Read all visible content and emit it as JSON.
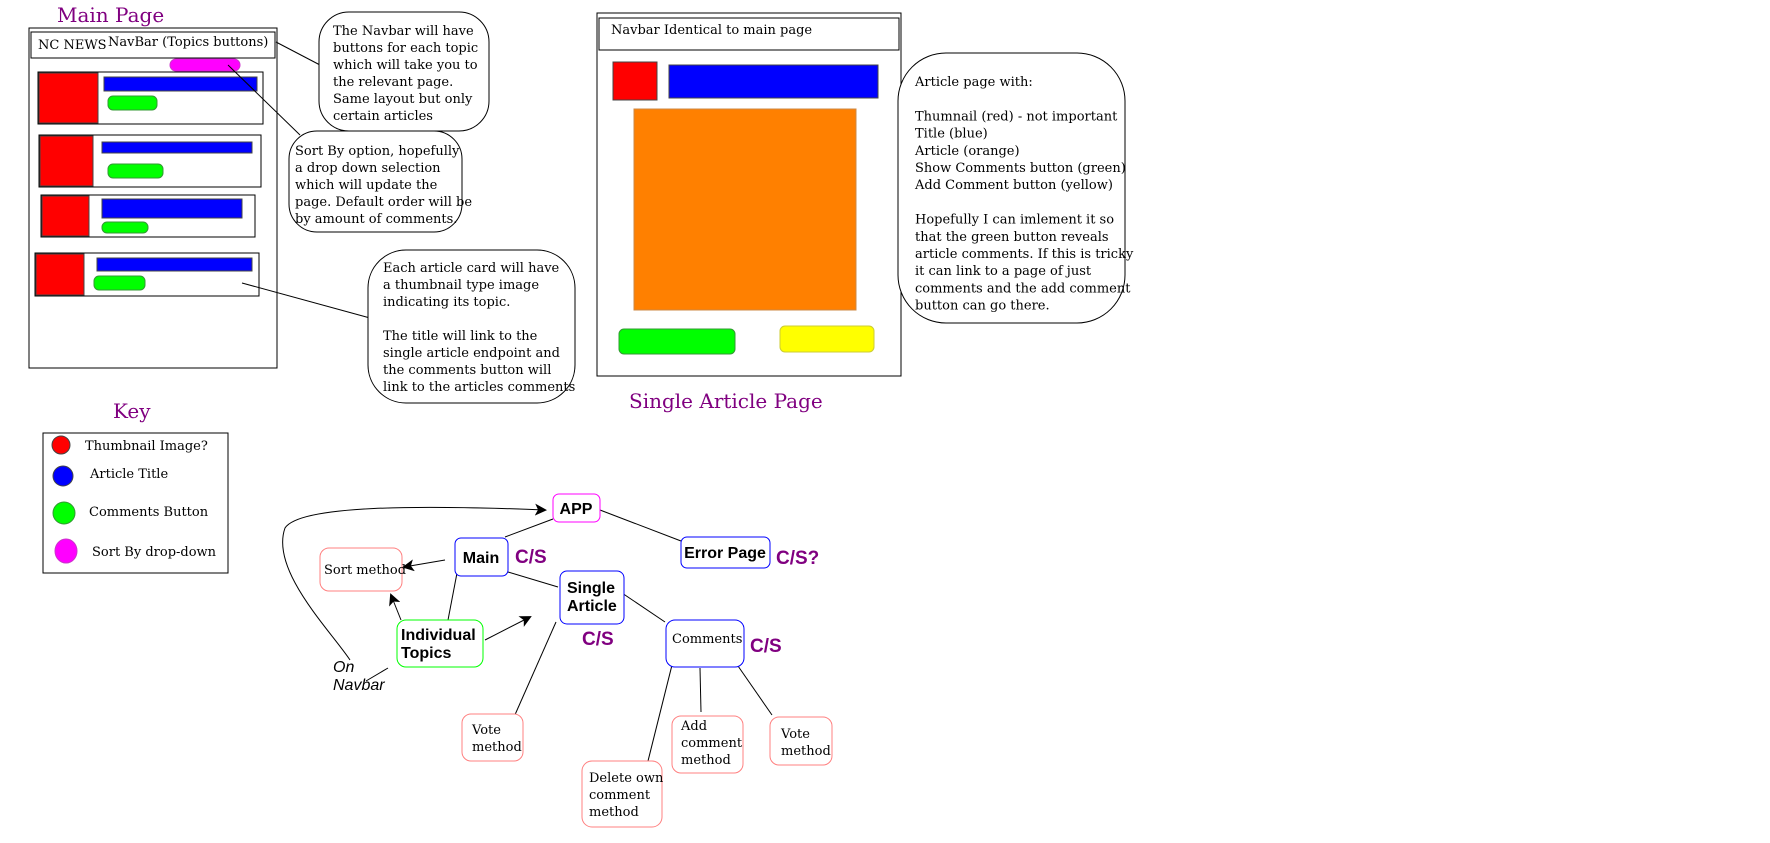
{
  "main_page": {
    "title": "Main Page",
    "navbar_brand": "NC NEWS",
    "navbar_label": "NavBar (Topics buttons)"
  },
  "single_article_page": {
    "title": "Single Article Page",
    "navbar_label": "Navbar Identical to main page"
  },
  "notes": {
    "navbar": [
      "The Navbar will have",
      "buttons for each topic",
      "which will take you to",
      "the relevant page.",
      "Same layout but only",
      "certain articles"
    ],
    "sort_by": [
      "Sort By option, hopefully",
      "a drop down selection",
      "which will update the",
      "page. Default order will be",
      "by amount of comments."
    ],
    "article_card": [
      "Each article card will have",
      "a thumbnail type image",
      "indicating its topic.",
      "",
      "The title will link to the",
      "single article endpoint and",
      "the comments button will",
      "link to the articles comments"
    ],
    "article_page": [
      "Article page with:",
      "",
      "Thumnail (red) - not important",
      "Title (blue)",
      "Article (orange)",
      "Show Comments button (green)",
      "Add Comment button (yellow)",
      "",
      "Hopefully I can imlement it so",
      "that the green button reveals",
      "article comments. If this is tricky",
      "it can link to a page of just",
      "comments and the add comment",
      "button can go there."
    ]
  },
  "key": {
    "title": "Key",
    "items": [
      {
        "label": "Thumbnail Image?",
        "color": "#ff0000"
      },
      {
        "label": "Article Title",
        "color": "#0000ff"
      },
      {
        "label": "Comments Button",
        "color": "#00ff00"
      },
      {
        "label": "Sort By drop-down",
        "color": "#ff00ff"
      }
    ]
  },
  "tree": {
    "app": "APP",
    "main": "Main",
    "main_cs": "C/S",
    "error_page": "Error Page",
    "error_cs": "C/S?",
    "single_article": [
      "Single",
      "Article"
    ],
    "single_article_cs": "C/S",
    "comments": "Comments",
    "comments_cs": "C/S",
    "individual_topics": [
      "Individual",
      "Topics"
    ],
    "sort_method": "Sort method",
    "on_navbar": [
      "On",
      "Navbar"
    ],
    "vote_method_article": [
      "Vote",
      "method"
    ],
    "delete_comment": [
      "Delete own",
      "comment",
      "method"
    ],
    "add_comment": [
      "Add",
      "comment",
      "method"
    ],
    "vote_method_comment": [
      "Vote",
      "method"
    ]
  },
  "colors": {
    "thumbnail": "#ff0000",
    "title": "#0000ff",
    "comments_button": "#00ff00",
    "sort_dropdown": "#ff00ff",
    "article": "#ff8000",
    "add_comment_button": "#ffff00",
    "heading": "#800080"
  }
}
